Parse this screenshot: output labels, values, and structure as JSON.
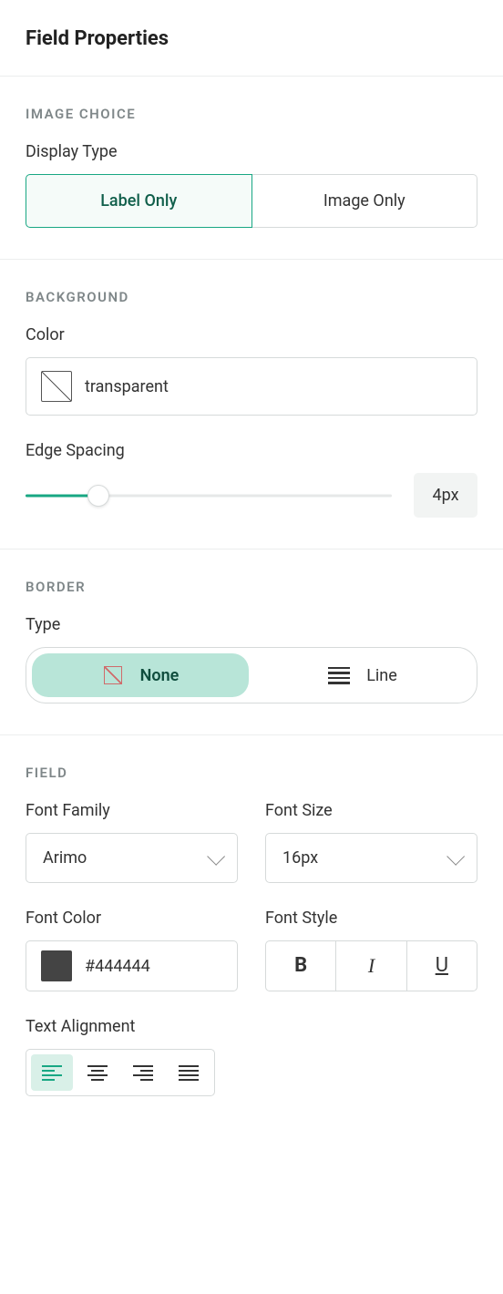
{
  "panel_title": "Field Properties",
  "image_choice": {
    "heading": "IMAGE CHOICE",
    "display_type_label": "Display Type",
    "options": {
      "label_only": "Label Only",
      "image_only": "Image Only"
    },
    "selected": "label_only"
  },
  "background": {
    "heading": "BACKGROUND",
    "color_label": "Color",
    "color_value": "transparent",
    "edge_spacing_label": "Edge Spacing",
    "edge_spacing_value": "4px",
    "edge_spacing_percent": 20
  },
  "border": {
    "heading": "BORDER",
    "type_label": "Type",
    "options": {
      "none": "None",
      "line": "Line"
    },
    "selected": "none"
  },
  "field": {
    "heading": "FIELD",
    "font_family_label": "Font Family",
    "font_family_value": "Arimo",
    "font_size_label": "Font Size",
    "font_size_value": "16px",
    "font_color_label": "Font Color",
    "font_color_value": "#444444",
    "font_style_label": "Font Style",
    "style_bold": "B",
    "style_italic": "I",
    "style_underline": "U",
    "text_alignment_label": "Text Alignment",
    "alignment_selected": "left"
  }
}
